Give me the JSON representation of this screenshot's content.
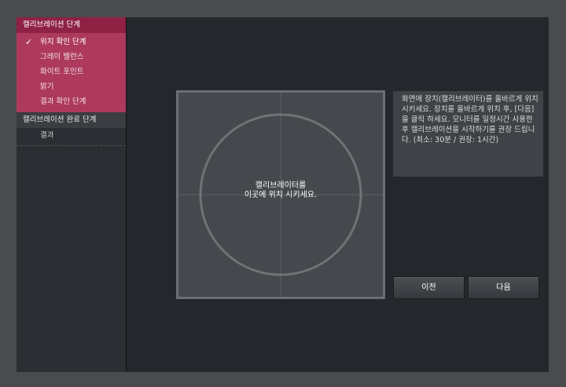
{
  "sidebar": {
    "section1": {
      "title": "캘리브레이션 단계",
      "items": [
        {
          "label": "위치 확인 단계",
          "checked": true
        },
        {
          "label": "그레이 밸런스"
        },
        {
          "label": "화이트 포인트"
        },
        {
          "label": "밝기"
        },
        {
          "label": "결과 확인 단계"
        }
      ]
    },
    "section2": {
      "title": "캘리브레이션 완료 단계",
      "items": [
        {
          "label": "결과"
        }
      ]
    },
    "check_glyph": "✓"
  },
  "target": {
    "line1": "캘리브레이터를",
    "line2": "이곳에 위치 시키세요."
  },
  "instructions": {
    "text": "화면에 장치(캘리브레이터)를 올바르게 위치 시키세요. 장치를 올바르게 위치 후, [다음]을 클릭 하세요. 모니터를 일정시간 사용한 후 캘리브레이션을 시작하기를 권장 드립니다. (최소: 30분 / 권장: 1시간)"
  },
  "buttons": {
    "prev": "이전",
    "next": "다음"
  },
  "colors": {
    "accent_dark": "#8f2145",
    "accent": "#ad3a5e",
    "panel": "#24272b"
  }
}
